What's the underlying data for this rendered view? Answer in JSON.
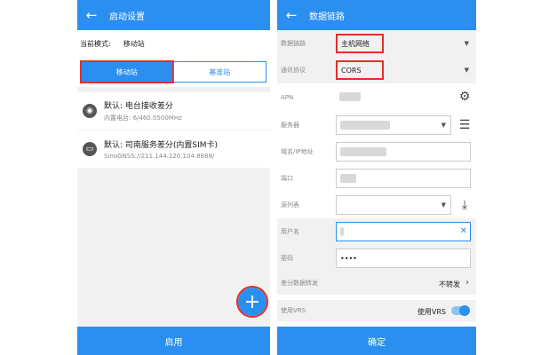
{
  "left": {
    "title": "启动设置",
    "back_icon": "arrow-left-icon",
    "current_mode_label": "当前模式:",
    "current_mode_value": "移动站",
    "tabs": [
      {
        "label": "移动站",
        "active": true
      },
      {
        "label": "基准站",
        "active": false
      }
    ],
    "items": [
      {
        "icon": "radio-icon",
        "title": "默认: 电台接收差分",
        "subtitle": "内置电台: 6/460.0500MHz"
      },
      {
        "icon": "server-icon",
        "title": "默认: 司南服务差分(内置SIM卡)",
        "subtitle": "SinoGNSS://211.144.120.104:8888/"
      }
    ],
    "fab_label": "+",
    "bottom_button": "启用"
  },
  "right": {
    "title": "数据链路",
    "back_icon": "arrow-left-icon",
    "rows": {
      "datalink": {
        "label": "数据链路",
        "value": "主机网络"
      },
      "protocol": {
        "label": "通讯协议",
        "value": "CORS"
      },
      "apn": {
        "label": "APN"
      },
      "server": {
        "label": "服务器"
      },
      "domain": {
        "label": "域名/IP地址"
      },
      "port": {
        "label": "端口"
      },
      "source": {
        "label": "源列表"
      },
      "username": {
        "label": "用户名"
      },
      "password": {
        "label": "密码",
        "value": "••••"
      },
      "forward": {
        "label": "差分数据转发",
        "value": "不转发"
      },
      "vrs": {
        "label": "使用VRS",
        "value": "使用VRS",
        "enabled": true
      }
    },
    "bottom_button": "确定"
  },
  "colors": {
    "accent": "#2b8ff0",
    "highlight": "#e0302a"
  }
}
